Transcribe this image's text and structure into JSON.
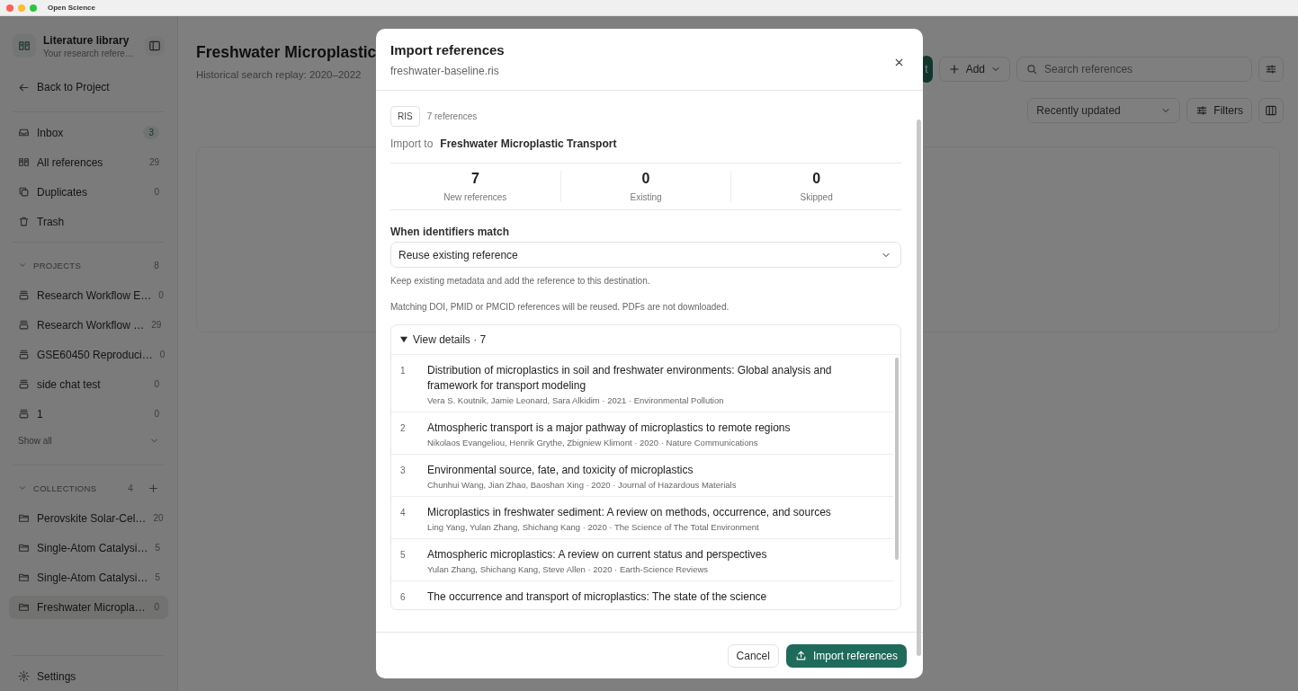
{
  "window": {
    "title": "Open Science"
  },
  "sidebar": {
    "title": "Literature library",
    "subtitle": "Your research refere…",
    "back": "Back to Project",
    "nav": [
      {
        "kind": "inbox",
        "label": "Inbox",
        "count": "3",
        "unread": true
      },
      {
        "kind": "book",
        "label": "All references",
        "count": "29",
        "unread": false
      },
      {
        "kind": "copy",
        "label": "Duplicates",
        "count": "0",
        "unread": false
      },
      {
        "kind": "trash",
        "label": "Trash"
      }
    ],
    "projects": {
      "label": "PROJECTS",
      "count": "8",
      "expanded": true,
      "show_all": "Show all",
      "items": [
        {
          "label": "Research Workflow E…",
          "count": "0"
        },
        {
          "label": "Research Workflow …",
          "count": "29"
        },
        {
          "label": "GSE60450 Reproduci…",
          "count": "0"
        },
        {
          "label": "side chat test",
          "count": "0"
        },
        {
          "label": "1",
          "count": "0"
        }
      ]
    },
    "collections": {
      "label": "COLLECTIONS",
      "count": "4",
      "expanded": true,
      "items": [
        {
          "label": "Perovskite Solar-Cel…",
          "count": "20",
          "selected": false
        },
        {
          "label": "Single-Atom Catalysi…",
          "count": "5",
          "selected": false
        },
        {
          "label": "Single-Atom Catalysi…",
          "count": "5",
          "selected": false
        },
        {
          "label": "Freshwater Micropla…",
          "count": "0",
          "selected": true
        }
      ]
    },
    "settings": "Settings"
  },
  "main": {
    "title": "Freshwater Microplastic",
    "subtitle": "Historical search replay: 2020–2022",
    "primary_button": "t",
    "add_button": "Add",
    "search": {
      "placeholder": "Search references"
    },
    "sort": "Recently updated",
    "filters_button": "Filters"
  },
  "dialog": {
    "title": "Import references",
    "file": "freshwater-baseline.ris",
    "format": "RIS",
    "count_text": "7 references",
    "import_to_label": "Import to",
    "destination": "Freshwater Microplastic Transport",
    "stats": [
      {
        "value": "7",
        "label": "New references"
      },
      {
        "value": "0",
        "label": "Existing"
      },
      {
        "value": "0",
        "label": "Skipped"
      }
    ],
    "match_label": "When identifiers match",
    "match_value": "Reuse existing reference",
    "hint": "Keep existing metadata and add the reference to this destination.",
    "note": "Matching DOI, PMID or PMCID references will be reused. PDFs are not downloaded.",
    "details": {
      "label": "View details · 7",
      "expanded": true,
      "rows": [
        {
          "number": "1",
          "title": "Distribution of microplastics in soil and freshwater environments: Global analysis and framework for transport modeling",
          "meta": "Vera S. Koutnik, Jamie Leonard, Sara Alkidim · 2021 · Environmental Pollution"
        },
        {
          "number": "2",
          "title": "Atmospheric transport is a major pathway of microplastics to remote regions",
          "meta": "Nikolaos Evangeliou, Henrik Grythe, Zbigniew Klimont · 2020 · Nature Communications"
        },
        {
          "number": "3",
          "title": "Environmental source, fate, and toxicity of microplastics",
          "meta": "Chunhui Wang, Jian Zhao, Baoshan Xing · 2020 · Journal of Hazardous Materials"
        },
        {
          "number": "4",
          "title": "Microplastics in freshwater sediment: A review on methods, occurrence, and sources",
          "meta": "Ling Yang, Yulan Zhang, Shichang Kang · 2020 · The Science of The Total Environment"
        },
        {
          "number": "5",
          "title": "Atmospheric microplastics: A review on current status and perspectives",
          "meta": "Yulan Zhang, Shichang Kang, Steve Allen · 2020 · Earth-Science Reviews"
        },
        {
          "number": "6",
          "title": "The occurrence and transport of microplastics: The state of the science"
        }
      ]
    },
    "cancel": "Cancel",
    "confirm": "Import references"
  }
}
